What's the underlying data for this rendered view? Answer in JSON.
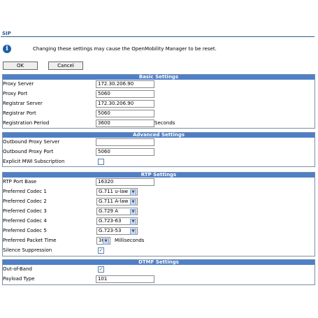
{
  "page": {
    "title": "SIP"
  },
  "info": {
    "text": "Changing these settings may cause the OpenMobility Manager to be reset."
  },
  "buttons": {
    "ok": "OK",
    "cancel": "Cancel"
  },
  "basic": {
    "header": "Basic Settings",
    "proxy_server_label": "Proxy Server",
    "proxy_server": "172.30.206.90",
    "proxy_port_label": "Proxy Port",
    "proxy_port": "5060",
    "registrar_server_label": "Registrar Server",
    "registrar_server": "172.30.206.90",
    "registrar_port_label": "Registrar Port",
    "registrar_port": "5060",
    "registration_period_label": "Registration Period",
    "registration_period": "3600",
    "seconds_label": "Seconds"
  },
  "advanced": {
    "header": "Advanced Settings",
    "outbound_proxy_server_label": "Outbound Proxy Server",
    "outbound_proxy_server": "",
    "outbound_proxy_port_label": "Outbound Proxy Port",
    "outbound_proxy_port": "5060",
    "mwi_label": "Explicit MWI Subscription",
    "mwi_checked": false
  },
  "rtp": {
    "header": "RTP Settings",
    "port_base_label": "RTP Port Base",
    "port_base": "16320",
    "codec1_label": "Preferred Codec 1",
    "codec1": "G.711 u-law",
    "codec2_label": "Preferred Codec 2",
    "codec2": "G.711 A-law",
    "codec3_label": "Preferred Codec 3",
    "codec3": "G.729 A",
    "codec4_label": "Preferred Codec 4",
    "codec4": "G.723-63",
    "codec5_label": "Preferred Codec 5",
    "codec5": "G.723-53",
    "packet_time_label": "Preferred Packet Time",
    "packet_time": "30",
    "milliseconds_label": "Milliseconds",
    "silence_label": "Silence Suppression",
    "silence_checked": true
  },
  "dtmf": {
    "header": "DTMF Settings",
    "out_of_band_label": "Out-of-Band",
    "out_of_band_checked": true,
    "payload_type_label": "Payload Type",
    "payload_type": "101"
  }
}
